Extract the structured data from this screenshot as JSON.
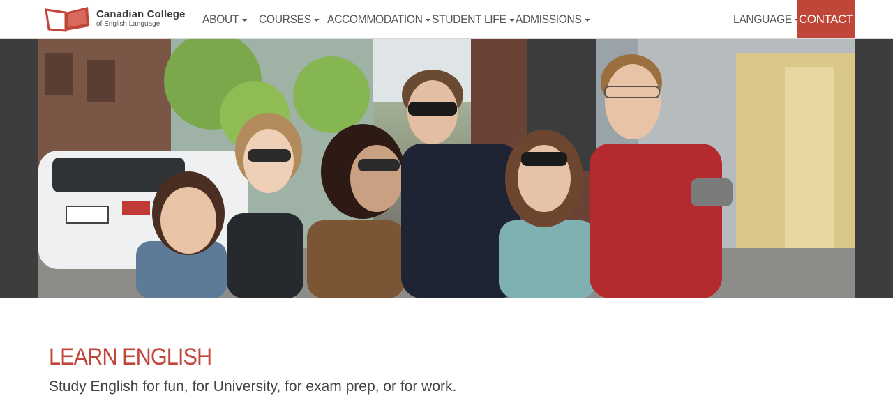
{
  "brand": {
    "name": "Canadian College",
    "subtitle": "of English Language",
    "logo_color": "#c1463a"
  },
  "nav": {
    "items": [
      {
        "label": "ABOUT",
        "has_dropdown": true
      },
      {
        "label": "COURSES",
        "has_dropdown": true
      },
      {
        "label": "ACCOMMODATION",
        "has_dropdown": true
      },
      {
        "label": "STUDENT LIFE",
        "has_dropdown": true
      },
      {
        "label": "ADMISSIONS",
        "has_dropdown": true
      }
    ],
    "language": {
      "label": "LANGUAGE",
      "has_dropdown": true
    },
    "contact": {
      "label": "CONTACT",
      "color": "#c1463a"
    }
  },
  "hero": {
    "icon": "group-photo-image"
  },
  "content": {
    "headline": "LEARN ENGLISH",
    "subline": "Study English for fun, for University, for exam prep, or for work.",
    "accent_color": "#c1463a"
  }
}
